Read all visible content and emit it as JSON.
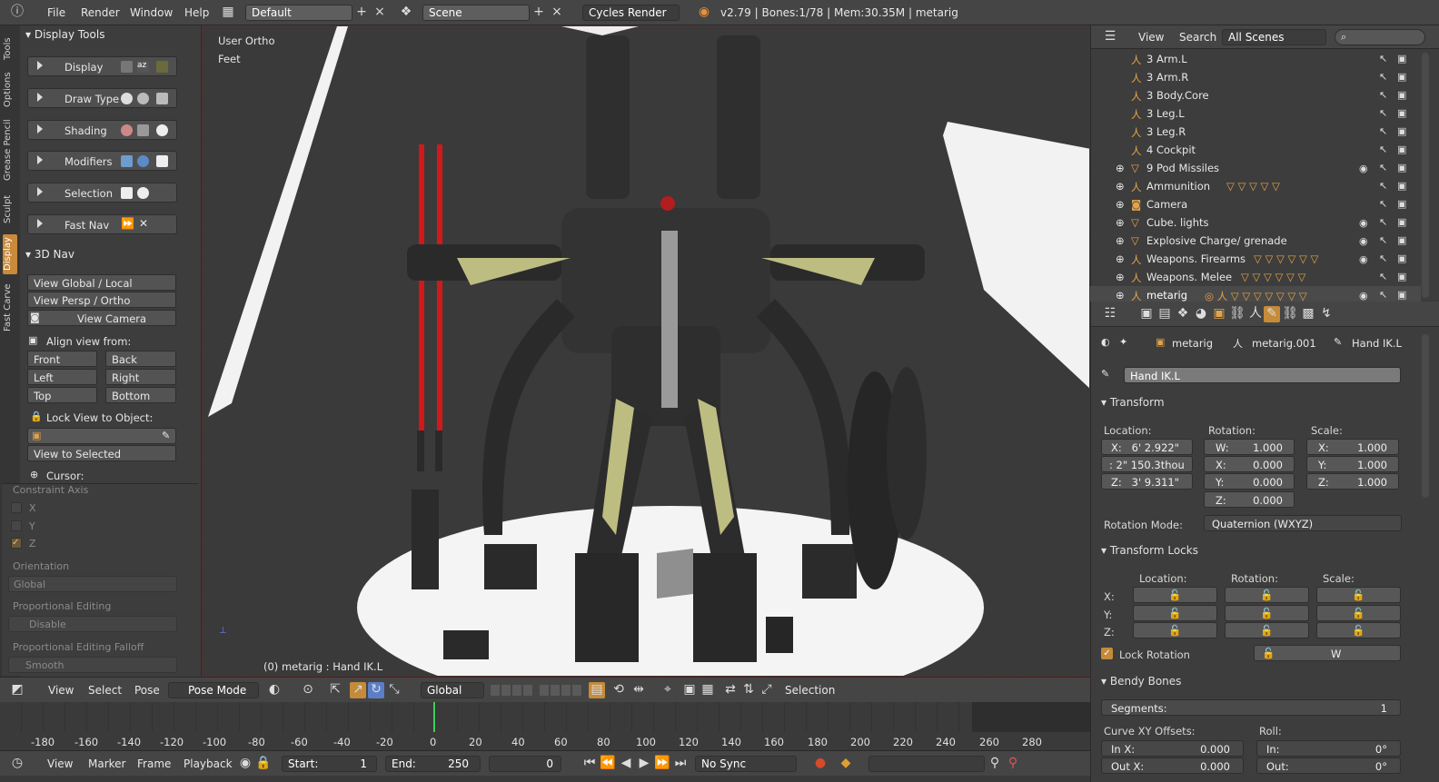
{
  "topbar": {
    "menus": [
      "File",
      "Render",
      "Window",
      "Help"
    ],
    "layout": "Default",
    "scene": "Scene",
    "engine": "Cycles Render",
    "status": "v2.79 | Bones:1/78 | Mem:30.35M | metarig"
  },
  "tabs": [
    "Tools",
    "Options",
    "Grease Pencil",
    "Sculpt",
    "Display",
    "Fast Carve"
  ],
  "toolshelf": {
    "display_tools": "Display Tools",
    "rows": [
      "Display",
      "Draw Type",
      "Shading",
      "Modifiers",
      "Selection",
      "Fast Nav"
    ],
    "nav_title": "3D Nav",
    "nav_buttons": [
      "View Global / Local",
      "View Persp / Ortho",
      "View Camera"
    ],
    "align_label": "Align view from:",
    "align": [
      "Front",
      "Back",
      "Left",
      "Right",
      "Top",
      "Bottom"
    ],
    "lock_label": "Lock View to Object:",
    "view_selected": "View to Selected",
    "cursor_label": "Cursor:",
    "constraint_axis": "Constraint Axis",
    "axes": [
      "X",
      "Y",
      "Z"
    ],
    "orientation_label": "Orientation",
    "orientation_value": "Global",
    "prop_edit_label": "Proportional Editing",
    "prop_edit_value": "Disable",
    "falloff_label": "Proportional Editing Falloff",
    "falloff_value": "Smooth"
  },
  "viewport": {
    "view_name": "User Ortho",
    "units": "Feet",
    "info": "(0) metarig : Hand IK.L"
  },
  "vpbar": {
    "menus": [
      "View",
      "Select",
      "Pose"
    ],
    "mode": "Pose Mode",
    "orientation": "Global",
    "mode_label": "Selection"
  },
  "timeline": {
    "ticks": [
      "-180",
      "-160",
      "-140",
      "-120",
      "-100",
      "-80",
      "-60",
      "-40",
      "-20",
      "0",
      "20",
      "40",
      "60",
      "80",
      "100",
      "120",
      "140",
      "160",
      "180",
      "200",
      "220",
      "240",
      "260",
      "280"
    ]
  },
  "tlbar": {
    "menus": [
      "View",
      "Marker",
      "Frame",
      "Playback"
    ],
    "start_label": "Start:",
    "start": "1",
    "end_label": "End:",
    "end": "250",
    "frame": "0",
    "sync": "No Sync"
  },
  "outliner": {
    "menus": [
      "View",
      "Search"
    ],
    "scenes": "All Scenes",
    "items": [
      "3 Arm.L",
      "3 Arm.R",
      "3 Body.Core",
      "3 Leg.L",
      "3 Leg.R",
      "4 Cockpit",
      "9 Pod Missiles",
      "Ammunition",
      "Camera",
      "Cube. lights",
      "Explosive Charge/ grenade",
      "Weapons. Firearms",
      "Weapons. Melee",
      "metarig"
    ]
  },
  "props": {
    "breadcrumb": [
      "metarig",
      "metarig.001",
      "Hand IK.L"
    ],
    "bone_name": "Hand IK.L",
    "transform": "Transform",
    "location_label": "Location:",
    "rotation_label": "Rotation:",
    "scale_label": "Scale:",
    "loc": [
      "X:",
      "6' 2.922\"",
      ": 2\" 150.3thou",
      "Z:",
      "3' 9.311\""
    ],
    "rot": [
      [
        "W:",
        "1.000"
      ],
      [
        "X:",
        "0.000"
      ],
      [
        "Y:",
        "0.000"
      ],
      [
        "Z:",
        "0.000"
      ]
    ],
    "scale": [
      [
        "X:",
        "1.000"
      ],
      [
        "Y:",
        "1.000"
      ],
      [
        "Z:",
        "1.000"
      ]
    ],
    "rotation_mode_label": "Rotation Mode:",
    "rotation_mode": "Quaternion (WXYZ)",
    "locks": "Transform Locks",
    "lock_axes": [
      "X:",
      "Y:",
      "Z:"
    ],
    "lock_rotation": "Lock Rotation",
    "lock_w": "W",
    "bendy": "Bendy Bones",
    "segments_label": "Segments:",
    "segments": "1",
    "curve_label": "Curve XY Offsets:",
    "roll_label": "Roll:",
    "in_x_label": "In X:",
    "in_x": "0.000",
    "out_x_label": "Out X:",
    "out_x": "0.000",
    "in_label": "In:",
    "in_val": "0°",
    "out_label": "Out:",
    "out_val": "0°"
  }
}
